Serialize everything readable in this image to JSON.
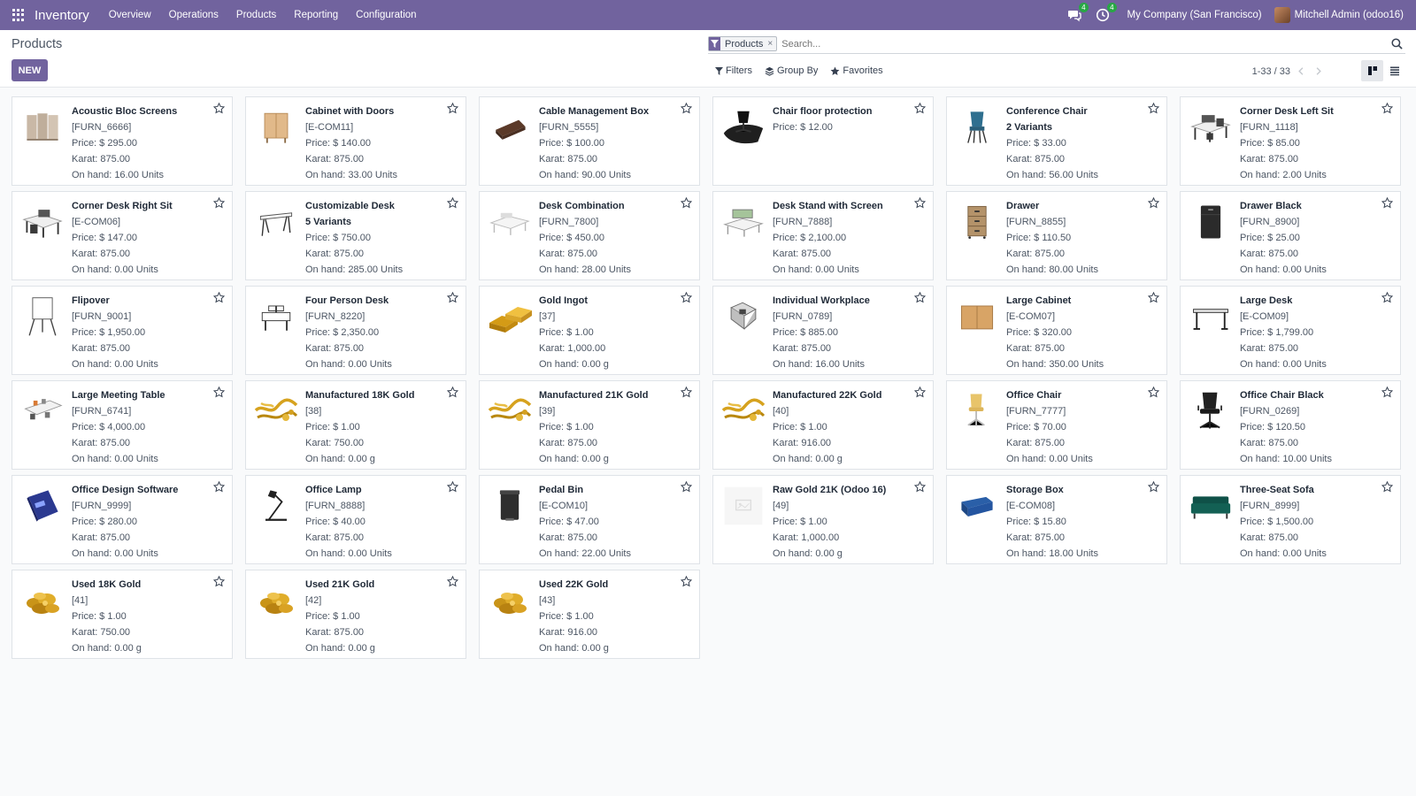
{
  "navbar": {
    "app_name": "Inventory",
    "menu": [
      "Overview",
      "Operations",
      "Products",
      "Reporting",
      "Configuration"
    ],
    "messages_count": "4",
    "activities_count": "4",
    "company": "My Company (San Francisco)",
    "user": "Mitchell Admin (odoo16)"
  },
  "control": {
    "breadcrumb": "Products",
    "new_label": "NEW",
    "facet_label": "Products",
    "search_placeholder": "Search...",
    "filters_label": "Filters",
    "groupby_label": "Group By",
    "favorites_label": "Favorites",
    "pager": "1-33 / 33"
  },
  "colors": {
    "brand": "#71639e",
    "badge": "#28a745"
  },
  "products": [
    {
      "name": "Acoustic Bloc Screens",
      "ref": "[FURN_6666]",
      "price": "Price: $ 295.00",
      "karat": "Karat: 875.00",
      "onhand": "On hand: 16.00 Units",
      "img": "screens"
    },
    {
      "name": "Cabinet with Doors",
      "ref": "[E-COM11]",
      "price": "Price: $ 140.00",
      "karat": "Karat: 875.00",
      "onhand": "On hand: 33.00 Units",
      "img": "cabinet"
    },
    {
      "name": "Cable Management Box",
      "ref": "[FURN_5555]",
      "price": "Price: $ 100.00",
      "karat": "Karat: 875.00",
      "onhand": "On hand: 90.00 Units",
      "img": "cablebox"
    },
    {
      "name": "Chair floor protection",
      "ref": "Price: $ 12.00",
      "price": "",
      "karat": "",
      "onhand": "",
      "img": "floormat"
    },
    {
      "name": "Conference Chair",
      "ref": "2 Variants",
      "price": "Price: $ 33.00",
      "karat": "Karat: 875.00",
      "onhand": "On hand: 56.00 Units",
      "img": "confchair",
      "refbold": true
    },
    {
      "name": "Corner Desk Left Sit",
      "ref": "[FURN_1118]",
      "price": "Price: $ 85.00",
      "karat": "Karat: 875.00",
      "onhand": "On hand: 2.00 Units",
      "img": "cornerdesk"
    },
    {
      "name": "Corner Desk Right Sit",
      "ref": "[E-COM06]",
      "price": "Price: $ 147.00",
      "karat": "Karat: 875.00",
      "onhand": "On hand: 0.00 Units",
      "img": "cornerdesk2"
    },
    {
      "name": "Customizable Desk",
      "ref": "5 Variants",
      "price": "Price: $ 750.00",
      "karat": "Karat: 875.00",
      "onhand": "On hand: 285.00 Units",
      "img": "desk",
      "refbold": true
    },
    {
      "name": "Desk Combination",
      "ref": "[FURN_7800]",
      "price": "Price: $ 450.00",
      "karat": "Karat: 875.00",
      "onhand": "On hand: 28.00 Units",
      "img": "deskcombo"
    },
    {
      "name": "Desk Stand with Screen",
      "ref": "[FURN_7888]",
      "price": "Price: $ 2,100.00",
      "karat": "Karat: 875.00",
      "onhand": "On hand: 0.00 Units",
      "img": "deskstand"
    },
    {
      "name": "Drawer",
      "ref": "[FURN_8855]",
      "price": "Price: $ 110.50",
      "karat": "Karat: 875.00",
      "onhand": "On hand: 80.00 Units",
      "img": "drawer"
    },
    {
      "name": "Drawer Black",
      "ref": "[FURN_8900]",
      "price": "Price: $ 25.00",
      "karat": "Karat: 875.00",
      "onhand": "On hand: 0.00 Units",
      "img": "drawerblack"
    },
    {
      "name": "Flipover",
      "ref": "[FURN_9001]",
      "price": "Price: $ 1,950.00",
      "karat": "Karat: 875.00",
      "onhand": "On hand: 0.00 Units",
      "img": "flipover"
    },
    {
      "name": "Four Person Desk",
      "ref": "[FURN_8220]",
      "price": "Price: $ 2,350.00",
      "karat": "Karat: 875.00",
      "onhand": "On hand: 0.00 Units",
      "img": "fourdesk"
    },
    {
      "name": "Gold Ingot",
      "ref": "[37]",
      "price": "Price: $ 1.00",
      "karat": "Karat: 1,000.00",
      "onhand": "On hand: 0.00 g",
      "img": "ingot"
    },
    {
      "name": "Individual Workplace",
      "ref": "[FURN_0789]",
      "price": "Price: $ 885.00",
      "karat": "Karat: 875.00",
      "onhand": "On hand: 16.00 Units",
      "img": "workplace"
    },
    {
      "name": "Large Cabinet",
      "ref": "[E-COM07]",
      "price": "Price: $ 320.00",
      "karat": "Karat: 875.00",
      "onhand": "On hand: 350.00 Units",
      "img": "largecabinet"
    },
    {
      "name": "Large Desk",
      "ref": "[E-COM09]",
      "price": "Price: $ 1,799.00",
      "karat": "Karat: 875.00",
      "onhand": "On hand: 0.00 Units",
      "img": "largedesk"
    },
    {
      "name": "Large Meeting Table",
      "ref": "[FURN_6741]",
      "price": "Price: $ 4,000.00",
      "karat": "Karat: 875.00",
      "onhand": "On hand: 0.00 Units",
      "img": "meetingtable"
    },
    {
      "name": "Manufactured 18K Gold",
      "ref": "[38]",
      "price": "Price: $ 1.00",
      "karat": "Karat: 750.00",
      "onhand": "On hand: 0.00 g",
      "img": "goldjewelry"
    },
    {
      "name": "Manufactured 21K Gold",
      "ref": "[39]",
      "price": "Price: $ 1.00",
      "karat": "Karat: 875.00",
      "onhand": "On hand: 0.00 g",
      "img": "goldjewelry"
    },
    {
      "name": "Manufactured 22K Gold",
      "ref": "[40]",
      "price": "Price: $ 1.00",
      "karat": "Karat: 916.00",
      "onhand": "On hand: 0.00 g",
      "img": "goldjewelry"
    },
    {
      "name": "Office Chair",
      "ref": "[FURN_7777]",
      "price": "Price: $ 70.00",
      "karat": "Karat: 875.00",
      "onhand": "On hand: 0.00 Units",
      "img": "officechair"
    },
    {
      "name": "Office Chair Black",
      "ref": "[FURN_0269]",
      "price": "Price: $ 120.50",
      "karat": "Karat: 875.00",
      "onhand": "On hand: 10.00 Units",
      "img": "chairblack"
    },
    {
      "name": "Office Design Software",
      "ref": "[FURN_9999]",
      "price": "Price: $ 280.00",
      "karat": "Karat: 875.00",
      "onhand": "On hand: 0.00 Units",
      "img": "software"
    },
    {
      "name": "Office Lamp",
      "ref": "[FURN_8888]",
      "price": "Price: $ 40.00",
      "karat": "Karat: 875.00",
      "onhand": "On hand: 0.00 Units",
      "img": "lamp"
    },
    {
      "name": "Pedal Bin",
      "ref": "[E-COM10]",
      "price": "Price: $ 47.00",
      "karat": "Karat: 875.00",
      "onhand": "On hand: 22.00 Units",
      "img": "bin"
    },
    {
      "name": "Raw Gold 21K (Odoo 16)",
      "ref": "[49]",
      "price": "Price: $ 1.00",
      "karat": "Karat: 1,000.00",
      "onhand": "On hand: 0.00 g",
      "img": "placeholder"
    },
    {
      "name": "Storage Box",
      "ref": "[E-COM08]",
      "price": "Price: $ 15.80",
      "karat": "Karat: 875.00",
      "onhand": "On hand: 18.00 Units",
      "img": "storagebox"
    },
    {
      "name": "Three-Seat Sofa",
      "ref": "[FURN_8999]",
      "price": "Price: $ 1,500.00",
      "karat": "Karat: 875.00",
      "onhand": "On hand: 0.00 Units",
      "img": "sofa"
    },
    {
      "name": "Used 18K Gold",
      "ref": "[41]",
      "price": "Price: $ 1.00",
      "karat": "Karat: 750.00",
      "onhand": "On hand: 0.00 g",
      "img": "goldcoins"
    },
    {
      "name": "Used 21K Gold",
      "ref": "[42]",
      "price": "Price: $ 1.00",
      "karat": "Karat: 875.00",
      "onhand": "On hand: 0.00 g",
      "img": "goldcoins"
    },
    {
      "name": "Used 22K Gold",
      "ref": "[43]",
      "price": "Price: $ 1.00",
      "karat": "Karat: 916.00",
      "onhand": "On hand: 0.00 g",
      "img": "goldcoins"
    }
  ]
}
